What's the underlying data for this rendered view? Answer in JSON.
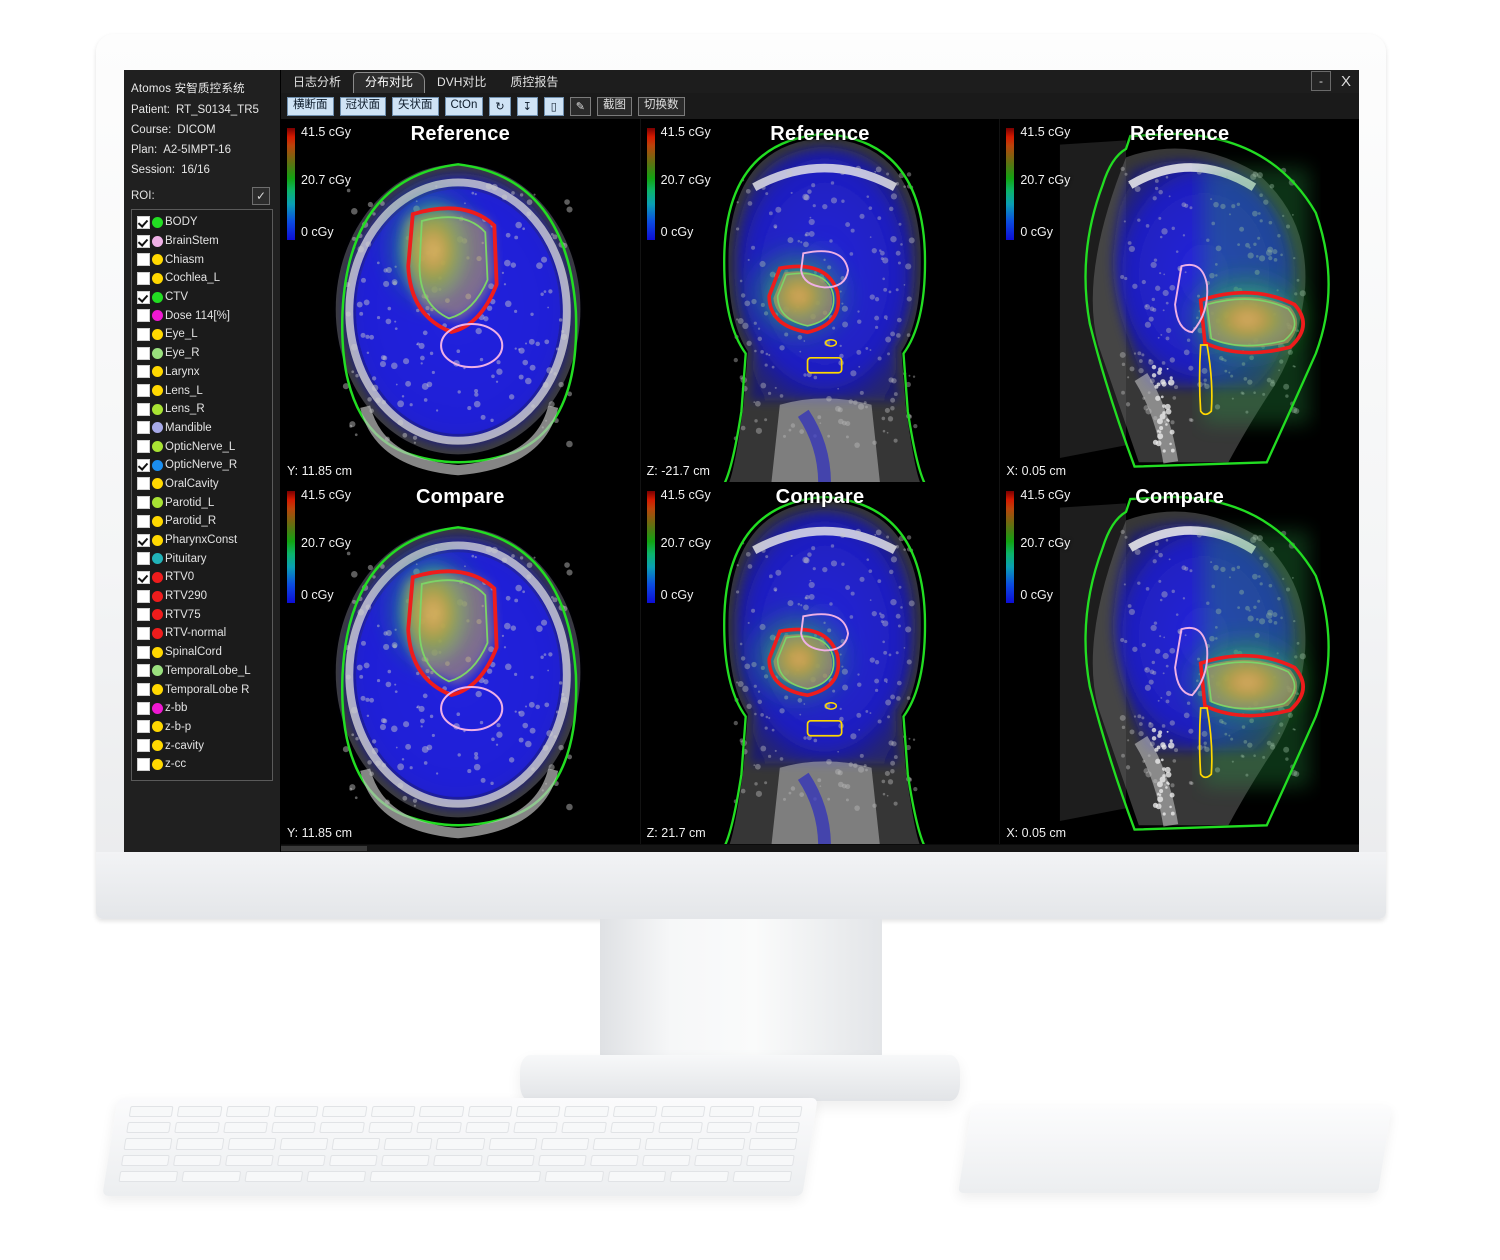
{
  "app": {
    "title": "Atomos 安智质控系统",
    "info": [
      {
        "label": "Patient:",
        "value": "RT_S0134_TR5"
      },
      {
        "label": "Course:",
        "value": "DICOM"
      },
      {
        "label": "Plan:",
        "value": "A2-5IMPT-16"
      },
      {
        "label": "Session:",
        "value": "16/16"
      }
    ],
    "roi_label": "ROI:",
    "roi_all_checked": "✓"
  },
  "window_controls": {
    "minimize": "-",
    "close": "X"
  },
  "tabs": [
    {
      "label": "日志分析",
      "active": false
    },
    {
      "label": "分布对比",
      "active": true
    },
    {
      "label": "DVH对比",
      "active": false
    },
    {
      "label": "质控报告",
      "active": false
    }
  ],
  "toolbar": [
    {
      "label": "横断面",
      "style": "accent"
    },
    {
      "label": "冠状面",
      "style": "accent"
    },
    {
      "label": "矢状面",
      "style": "accent"
    },
    {
      "label": "CtOn",
      "style": "accent"
    },
    {
      "label": "↻",
      "style": "accent",
      "name": "rotate-icon"
    },
    {
      "label": "↧",
      "style": "accent",
      "name": "download-icon"
    },
    {
      "label": "▯",
      "style": "accent",
      "name": "ruler-icon"
    },
    {
      "label": "✎",
      "style": "plain",
      "name": "pencil-icon"
    },
    {
      "label": "截图",
      "style": "plain"
    },
    {
      "label": "切换数",
      "style": "plain"
    }
  ],
  "roi_list": [
    {
      "name": "BODY",
      "color": "#22dd22",
      "checked": true
    },
    {
      "name": "BrainStem",
      "color": "#efb0e6",
      "checked": true
    },
    {
      "name": "Chiasm",
      "color": "#ffd800",
      "checked": false
    },
    {
      "name": "Cochlea_L",
      "color": "#ffd800",
      "checked": false
    },
    {
      "name": "CTV",
      "color": "#22dd22",
      "checked": true
    },
    {
      "name": "Dose 114[%]",
      "color": "#ef18d2",
      "checked": false
    },
    {
      "name": "Eye_L",
      "color": "#ffd800",
      "checked": false
    },
    {
      "name": "Eye_R",
      "color": "#9ae07e",
      "checked": false
    },
    {
      "name": "Larynx",
      "color": "#ffd800",
      "checked": false
    },
    {
      "name": "Lens_L",
      "color": "#ffd800",
      "checked": false
    },
    {
      "name": "Lens_R",
      "color": "#a8e233",
      "checked": false
    },
    {
      "name": "Mandible",
      "color": "#a7a9e8",
      "checked": false
    },
    {
      "name": "OpticNerve_L",
      "color": "#a8e233",
      "checked": false
    },
    {
      "name": "OpticNerve_R",
      "color": "#1b8ef0",
      "checked": true
    },
    {
      "name": "OralCavity",
      "color": "#ffd800",
      "checked": false
    },
    {
      "name": "Parotid_L",
      "color": "#a8e233",
      "checked": false
    },
    {
      "name": "Parotid_R",
      "color": "#ffd800",
      "checked": false
    },
    {
      "name": "PharynxConst",
      "color": "#ffd800",
      "checked": true
    },
    {
      "name": "Pituitary",
      "color": "#21b3b8",
      "checked": false
    },
    {
      "name": "RTV0",
      "color": "#ee1c1c",
      "checked": true
    },
    {
      "name": "RTV290",
      "color": "#ee1c1c",
      "checked": false
    },
    {
      "name": "RTV75",
      "color": "#ee1c1c",
      "checked": false
    },
    {
      "name": "RTV-normal",
      "color": "#ee1c1c",
      "checked": false
    },
    {
      "name": "SpinalCord",
      "color": "#ffd800",
      "checked": false
    },
    {
      "name": "TemporalLobe_L",
      "color": "#9ae07e",
      "checked": false
    },
    {
      "name": "TemporalLobe R",
      "color": "#ffd800",
      "checked": false
    },
    {
      "name": "z-bb",
      "color": "#ef18d2",
      "checked": false
    },
    {
      "name": "z-b-p",
      "color": "#ffd800",
      "checked": false
    },
    {
      "name": "z-cavity",
      "color": "#ffd800",
      "checked": false
    },
    {
      "name": "z-cc",
      "color": "#ffd800",
      "checked": false
    }
  ],
  "colorbar": {
    "max": "41.5 cGy",
    "mid": "20.7 cGy",
    "min": "0 cGy"
  },
  "panels": [
    {
      "title": "Reference",
      "coord": "Y: 11.85 cm",
      "plane": "axial",
      "row": "reference"
    },
    {
      "title": "Reference",
      "coord": "Z: -21.7 cm",
      "plane": "coronal",
      "row": "reference"
    },
    {
      "title": "Reference",
      "coord": "X: 0.05 cm",
      "plane": "sagittal",
      "row": "reference"
    },
    {
      "title": "Compare",
      "coord": "Y: 11.85 cm",
      "plane": "axial",
      "row": "compare"
    },
    {
      "title": "Compare",
      "coord": "Z:  21.7 cm",
      "plane": "coronal",
      "row": "compare"
    },
    {
      "title": "Compare",
      "coord": "X: 0.05 cm",
      "plane": "sagittal",
      "row": "compare"
    }
  ],
  "colors": {
    "accent_button": "#cfe3f5",
    "sidebar_bg": "#202020",
    "screen_bg": "#000000",
    "contour_body": "#22dd22",
    "contour_target": "#ee1c1c",
    "contour_brainstem": "#efb0e6",
    "contour_pharynx": "#ffd800"
  }
}
